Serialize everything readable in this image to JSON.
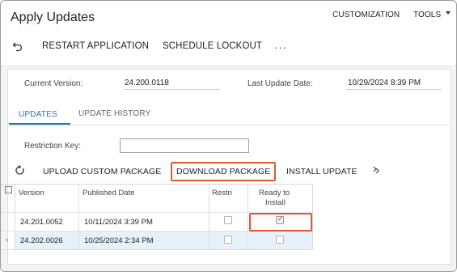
{
  "header": {
    "title": "Apply Updates",
    "customization_label": "CUSTOMIZATION",
    "tools_label": "TOOLS"
  },
  "toolbar": {
    "undo_icon": "undo-icon",
    "restart_label": "RESTART APPLICATION",
    "schedule_lockout_label": "SCHEDULE LOCKOUT",
    "more_label": "···"
  },
  "summary": {
    "current_version_label": "Current Version:",
    "current_version_value": "24.200.0118",
    "last_update_label": "Last Update Date:",
    "last_update_value": "10/29/2024 8:39 PM"
  },
  "tabs": [
    {
      "label": "UPDATES",
      "active": true
    },
    {
      "label": "UPDATE HISTORY",
      "active": false
    }
  ],
  "filter": {
    "restriction_key_label": "Restriction Key:",
    "restriction_key_value": ""
  },
  "grid_toolbar": {
    "refresh_icon": "refresh-icon",
    "upload_label": "UPLOAD CUSTOM PACKAGE",
    "download_label": "DOWNLOAD PACKAGE",
    "install_label": "INSTALL UPDATE",
    "fit_icon": "fit-columns-icon"
  },
  "grid": {
    "columns": [
      "Version",
      "Published Date",
      "Restri",
      "Ready to",
      "Install"
    ],
    "rows": [
      {
        "version": "24.201.0052",
        "published": "10/11/2024 3:39 PM",
        "restricted": false,
        "ready": true
      },
      {
        "version": "24.202.0026",
        "published": "10/25/2024 2:34 PM",
        "restricted": false,
        "ready": false
      }
    ]
  },
  "colors": {
    "accent": "#1a76c4",
    "highlight": "#e05a2b",
    "selected_row": "#e6f1fb"
  }
}
